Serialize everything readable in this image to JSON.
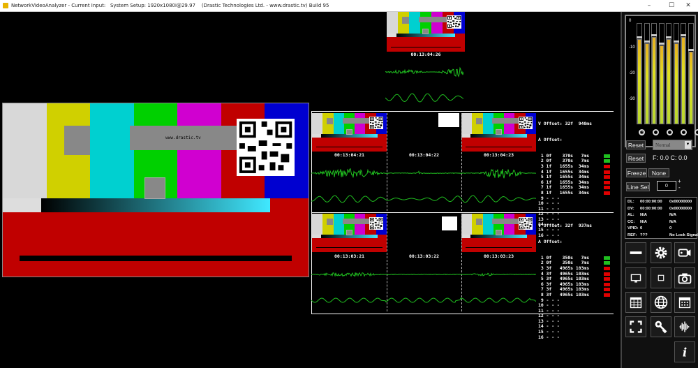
{
  "window": {
    "title": "NetworkVideoAnalyzer - Current Input:   System Setup: 1920x1080i@29.97    (Drastic Technologies Ltd. - www.drastic.tv) Build 95",
    "minimize": "–",
    "maximize": "☐",
    "close": "✕"
  },
  "testpattern": {
    "label": "www.drastic.tv",
    "bar_colors": [
      "#d8d8d8",
      "#d0d000",
      "#00d0d0",
      "#00d000",
      "#d000d0",
      "#c00000",
      "#0000d0"
    ]
  },
  "thumbs": {
    "t0": {
      "timecode": "00:13:04:26"
    },
    "t1": {
      "timecode": "00:13:04:21"
    },
    "t2": {
      "timecode": "00:13:04:22"
    },
    "t3": {
      "timecode": "00:13:04:23"
    },
    "t4": {
      "timecode": "00:13:03:21"
    },
    "t5": {
      "timecode": "00:13:03:22"
    },
    "t6": {
      "timecode": "00:13:03:23"
    }
  },
  "audio1": {
    "v_offset": "V Offset: 32f  940ms",
    "a_offset": "A Offset:",
    "rows": [
      {
        "t": " 1 0f    370s   7ms",
        "c": "#20c020"
      },
      {
        "t": " 2 0f    370s   7ms",
        "c": "#20c020"
      },
      {
        "t": " 3 1f   1655s  34ms",
        "c": "#e00000"
      },
      {
        "t": " 4 1f   1655s  34ms",
        "c": "#e00000"
      },
      {
        "t": " 5 1f   1655s  34ms",
        "c": "#e00000"
      },
      {
        "t": " 6 1f   1655s  34ms",
        "c": "#e00000"
      },
      {
        "t": " 7 1f   1655s  34ms",
        "c": "#e00000"
      },
      {
        "t": " 8 1f   1655s  34ms",
        "c": "#e00000"
      },
      {
        "t": " 9 - - -",
        "c": ""
      },
      {
        "t": "10 - - -",
        "c": ""
      },
      {
        "t": "11 - - -",
        "c": ""
      },
      {
        "t": "12 - - -",
        "c": ""
      },
      {
        "t": "13 - - -",
        "c": ""
      },
      {
        "t": "14 - - -",
        "c": ""
      },
      {
        "t": "15 - - -",
        "c": ""
      },
      {
        "t": "16 - - -",
        "c": ""
      }
    ]
  },
  "audio2": {
    "v_offset": "V Offset: 32f  937ms",
    "a_offset": "A Offset:",
    "rows": [
      {
        "t": " 1 0f    350s   7ms",
        "c": "#20c020"
      },
      {
        "t": " 2 0f    350s   7ms",
        "c": "#20c020"
      },
      {
        "t": " 3 3f   4965s 103ms",
        "c": "#e00000"
      },
      {
        "t": " 4 3f   4965s 103ms",
        "c": "#e00000"
      },
      {
        "t": " 5 3f   4965s 103ms",
        "c": "#e00000"
      },
      {
        "t": " 6 3f   4965s 103ms",
        "c": "#e00000"
      },
      {
        "t": " 7 3f   4965s 103ms",
        "c": "#e00000"
      },
      {
        "t": " 8 3f   4965s 103ms",
        "c": "#e00000"
      },
      {
        "t": " 9 - - -",
        "c": ""
      },
      {
        "t": "10 - - -",
        "c": ""
      },
      {
        "t": "11 - - -",
        "c": ""
      },
      {
        "t": "12 - - -",
        "c": ""
      },
      {
        "t": "13 - - -",
        "c": ""
      },
      {
        "t": "14 - - -",
        "c": ""
      },
      {
        "t": "15 - - -",
        "c": ""
      },
      {
        "t": "16 - - -",
        "c": ""
      }
    ]
  },
  "meter": {
    "ticks": [
      "0",
      "-10",
      "-20",
      "-30"
    ],
    "channel_levels": [
      0.84,
      0.8,
      0.86,
      0.78,
      0.84,
      0.8,
      0.86,
      0.72
    ]
  },
  "controls": {
    "reset1": "Reset",
    "normal": "Normal",
    "reset2": "Reset",
    "fc": "F: 0.0  C: 0.0",
    "freeze": "Freeze",
    "none": "None",
    "linesel": "Line Sel",
    "linesel_value": "0",
    "plus": "+",
    "minus": "-"
  },
  "status": {
    "rows": [
      {
        "k": "DL:",
        "v": "00:00:00:00",
        "x": "0x00000000"
      },
      {
        "k": "DV:",
        "v": "00:00:00:00",
        "x": "0x00000000"
      },
      {
        "k": "AL:",
        "v": "N/A",
        "x": "N/A"
      },
      {
        "k": "CC:",
        "v": "N/A",
        "x": "N/A"
      },
      {
        "k": "VPID:",
        "v": "0",
        "x": "0"
      },
      {
        "k": "REF:",
        "v": "???",
        "x": "No Lock Signal P"
      }
    ]
  },
  "icons": [
    "line-icon",
    "gear-icon",
    "record-icon",
    "monitor-icon",
    "stop-icon",
    "camera-icon",
    "grid-icon",
    "globe-icon",
    "calendar-icon",
    "fullscreen-icon",
    "key-icon",
    "audio-wave-icon",
    "info-icon"
  ]
}
